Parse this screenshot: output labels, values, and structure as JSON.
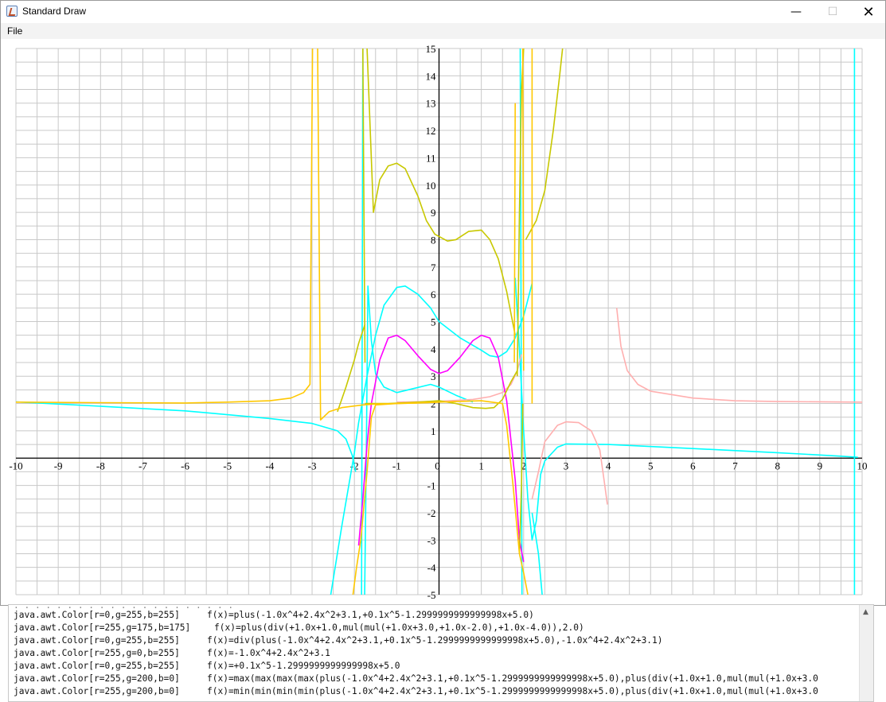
{
  "window": {
    "title": "Standard Draw",
    "minimize_label": "—",
    "maximize_label": "☐",
    "close_label": "✕",
    "menu": [
      "File"
    ]
  },
  "chart_data": {
    "type": "line",
    "title": "",
    "xlabel": "",
    "ylabel": "",
    "xlim": [
      -10,
      10
    ],
    "ylim": [
      -5,
      15
    ],
    "grid": true,
    "x_ticks": [
      "-10",
      "-9",
      "-8",
      "-7",
      "-6",
      "-5",
      "-4",
      "-3",
      "-2",
      "-1",
      "0",
      "1",
      "2",
      "3",
      "4",
      "5",
      "6",
      "7",
      "8",
      "9",
      "10"
    ],
    "y_ticks": [
      "-5",
      "-4",
      "-3",
      "-2",
      "-1",
      "1",
      "2",
      "3",
      "4",
      "5",
      "6",
      "7",
      "8",
      "9",
      "10",
      "11",
      "12",
      "13",
      "14",
      "15"
    ],
    "series": [
      {
        "color": "#00ffff",
        "points": [
          [
            -10,
            2.06
          ],
          [
            -8,
            1.9
          ],
          [
            -6,
            1.73
          ],
          [
            -4,
            1.45
          ],
          [
            -3,
            1.27
          ],
          [
            -2.4,
            1.0
          ],
          [
            -2.2,
            0.7
          ],
          [
            -2.05,
            0.1
          ],
          [
            -1.97,
            -0.5
          ]
        ]
      },
      {
        "color": "#00ffff",
        "points": [
          [
            -2.6,
            -5.4
          ],
          [
            -2.3,
            -2.5
          ],
          [
            -2.0,
            0.2
          ],
          [
            -1.9,
            1.3
          ],
          [
            -1.7,
            3.0
          ],
          [
            -1.5,
            4.5
          ],
          [
            -1.3,
            5.6
          ],
          [
            -1.0,
            6.25
          ],
          [
            -0.8,
            6.3
          ],
          [
            -0.5,
            6.0
          ],
          [
            -0.2,
            5.5
          ],
          [
            0,
            5.0
          ],
          [
            0.5,
            4.4
          ],
          [
            1.0,
            3.95
          ],
          [
            1.2,
            3.75
          ],
          [
            1.4,
            3.7
          ],
          [
            1.6,
            3.9
          ],
          [
            1.8,
            4.4
          ],
          [
            2.0,
            5.2
          ],
          [
            2.1,
            5.8
          ],
          [
            2.2,
            6.4
          ]
        ]
      },
      {
        "color": "#00ffff",
        "points": [
          [
            -1.76,
            -5.2
          ],
          [
            -1.72,
            0
          ],
          [
            -1.68,
            6.3
          ],
          [
            -1.6,
            4.3
          ],
          [
            -1.5,
            3.1
          ],
          [
            -1.3,
            2.6
          ],
          [
            -1.0,
            2.4
          ],
          [
            -0.6,
            2.55
          ],
          [
            -0.2,
            2.7
          ],
          [
            0,
            2.6
          ],
          [
            0.4,
            2.3
          ],
          [
            0.8,
            2.05
          ]
        ]
      },
      {
        "color": "#00ffff",
        "points": [
          [
            1.8,
            6.6
          ],
          [
            1.9,
            4.0
          ],
          [
            2.0,
            1.0
          ],
          [
            2.1,
            -1.5
          ],
          [
            2.2,
            -3.0
          ],
          [
            2.3,
            -2.3
          ],
          [
            2.4,
            -0.6
          ],
          [
            2.5,
            -0.1
          ],
          [
            2.8,
            0.4
          ],
          [
            3.0,
            0.52
          ],
          [
            4.0,
            0.5
          ],
          [
            6.0,
            0.35
          ],
          [
            8.0,
            0.2
          ],
          [
            9.5,
            0.07
          ],
          [
            9.9,
            0.03
          ]
        ]
      },
      {
        "color": "#00ffff",
        "points": [
          [
            2.2,
            -2.0
          ],
          [
            2.35,
            -3.5
          ],
          [
            2.45,
            -5.2
          ]
        ]
      },
      {
        "color": "#00ffff",
        "points": [
          [
            -1.83,
            -5
          ],
          [
            -1.8,
            15
          ]
        ]
      },
      {
        "color": "#00ffff",
        "points": [
          [
            1.92,
            15
          ],
          [
            1.96,
            -5
          ]
        ]
      },
      {
        "color": "#00ffff",
        "points": [
          [
            9.82,
            -5
          ],
          [
            9.82,
            15
          ]
        ]
      },
      {
        "color": "#ffafaf",
        "points": [
          [
            -1.0,
            2.05
          ],
          [
            0,
            2.08
          ],
          [
            0.8,
            2.15
          ],
          [
            1.2,
            2.25
          ],
          [
            1.5,
            2.4
          ],
          [
            1.7,
            2.7
          ],
          [
            1.85,
            3.2
          ],
          [
            1.95,
            3.8
          ]
        ]
      },
      {
        "color": "#ffafaf",
        "points": [
          [
            2.2,
            -1.5
          ],
          [
            2.35,
            -0.5
          ],
          [
            2.5,
            0.6
          ],
          [
            2.8,
            1.2
          ],
          [
            3.0,
            1.33
          ],
          [
            3.3,
            1.3
          ],
          [
            3.6,
            1.0
          ],
          [
            3.8,
            0.3
          ],
          [
            3.9,
            -0.8
          ],
          [
            3.98,
            -1.7
          ]
        ]
      },
      {
        "color": "#ffafaf",
        "points": [
          [
            4.2,
            5.5
          ],
          [
            4.3,
            4.1
          ],
          [
            4.45,
            3.2
          ],
          [
            4.7,
            2.7
          ],
          [
            5.0,
            2.45
          ],
          [
            6.0,
            2.2
          ],
          [
            7.0,
            2.1
          ],
          [
            8.0,
            2.07
          ],
          [
            10.0,
            2.05
          ]
        ]
      },
      {
        "color": "#ff00ff",
        "points": [
          [
            -1.9,
            -3.2
          ],
          [
            -1.8,
            -1.5
          ],
          [
            -1.7,
            0.5
          ],
          [
            -1.6,
            2.0
          ],
          [
            -1.4,
            3.6
          ],
          [
            -1.2,
            4.4
          ],
          [
            -1.0,
            4.5
          ],
          [
            -0.8,
            4.3
          ],
          [
            -0.5,
            3.75
          ],
          [
            -0.2,
            3.25
          ],
          [
            0,
            3.1
          ],
          [
            0.2,
            3.2
          ],
          [
            0.5,
            3.7
          ],
          [
            0.8,
            4.3
          ],
          [
            1.0,
            4.5
          ],
          [
            1.2,
            4.4
          ],
          [
            1.4,
            3.7
          ],
          [
            1.6,
            2.1
          ],
          [
            1.8,
            -0.8
          ],
          [
            1.9,
            -3.0
          ],
          [
            2.0,
            -3.8
          ]
        ]
      },
      {
        "color": "#c8c800",
        "points": [
          [
            -2.4,
            1.7
          ],
          [
            -2.2,
            2.6
          ],
          [
            -2.0,
            3.6
          ],
          [
            -1.9,
            4.2
          ],
          [
            -1.75,
            4.9
          ]
        ]
      },
      {
        "color": "#c8c800",
        "points": [
          [
            -1.7,
            15
          ],
          [
            -1.55,
            9.0
          ],
          [
            -1.4,
            10.2
          ],
          [
            -1.2,
            10.7
          ],
          [
            -1.0,
            10.8
          ],
          [
            -0.8,
            10.6
          ],
          [
            -0.5,
            9.6
          ],
          [
            -0.3,
            8.7
          ],
          [
            -0.1,
            8.2
          ],
          [
            0.2,
            7.95
          ],
          [
            0.4,
            8.0
          ],
          [
            0.7,
            8.3
          ],
          [
            1.0,
            8.35
          ],
          [
            1.2,
            8.0
          ],
          [
            1.4,
            7.3
          ],
          [
            1.6,
            6.1
          ],
          [
            1.8,
            4.5
          ]
        ]
      },
      {
        "color": "#c8c800",
        "points": [
          [
            -1.75,
            2.0
          ],
          [
            -1.2,
            2.0
          ],
          [
            -0.5,
            2.05
          ],
          [
            0,
            2.1
          ],
          [
            0.4,
            2.0
          ],
          [
            0.8,
            1.85
          ],
          [
            1.1,
            1.82
          ],
          [
            1.3,
            1.85
          ],
          [
            1.5,
            2.15
          ],
          [
            1.7,
            2.8
          ],
          [
            1.85,
            3.2
          ]
        ]
      },
      {
        "color": "#c8c800",
        "points": [
          [
            -1.75,
            3.5
          ],
          [
            -1.8,
            15
          ]
        ]
      },
      {
        "color": "#c8c800",
        "points": [
          [
            1.85,
            3.0
          ],
          [
            1.9,
            9.0
          ],
          [
            1.95,
            13.5
          ],
          [
            2.0,
            15
          ]
        ]
      },
      {
        "color": "#c8c800",
        "points": [
          [
            2.05,
            8.0
          ],
          [
            2.3,
            8.7
          ],
          [
            2.5,
            9.8
          ],
          [
            2.7,
            12.0
          ],
          [
            2.85,
            14.0
          ],
          [
            2.92,
            15
          ]
        ]
      },
      {
        "color": "#c8c800",
        "points": [
          [
            1.9,
            -3.5
          ],
          [
            1.95,
            -1.0
          ],
          [
            1.98,
            2.0
          ]
        ]
      },
      {
        "color": "#ffc800",
        "points": [
          [
            -10,
            2.05
          ],
          [
            -8,
            2.03
          ],
          [
            -6,
            2.02
          ],
          [
            -5,
            2.05
          ],
          [
            -4,
            2.1
          ],
          [
            -3.5,
            2.2
          ],
          [
            -3.2,
            2.4
          ],
          [
            -3.05,
            2.7
          ],
          [
            -2.99,
            15
          ]
        ]
      },
      {
        "color": "#ffc800",
        "points": [
          [
            -2.87,
            15
          ],
          [
            -2.8,
            1.4
          ],
          [
            -2.6,
            1.7
          ],
          [
            -2.3,
            1.85
          ],
          [
            -1.8,
            1.95
          ],
          [
            -1.5,
            1.98
          ],
          [
            -0.5,
            2.02
          ],
          [
            0,
            2.05
          ]
        ]
      },
      {
        "color": "#ffc800",
        "points": [
          [
            -2.05,
            -5.2
          ],
          [
            -1.95,
            -4.0
          ],
          [
            -1.85,
            -3.0
          ],
          [
            -1.7,
            -0.5
          ],
          [
            -1.6,
            1.5
          ],
          [
            -1.5,
            1.95
          ],
          [
            -1.0,
            2.0
          ],
          [
            0,
            2.05
          ],
          [
            1.0,
            2.1
          ],
          [
            1.5,
            2.0
          ],
          [
            1.6,
            1.2
          ],
          [
            1.75,
            -1.0
          ],
          [
            1.9,
            -3.5
          ],
          [
            2.0,
            -4.2
          ],
          [
            2.1,
            -5.0
          ],
          [
            2.15,
            -5.5
          ]
        ]
      },
      {
        "color": "#ffc800",
        "points": [
          [
            1.78,
            3.5
          ],
          [
            1.8,
            13.0
          ]
        ]
      },
      {
        "color": "#ffc800",
        "points": [
          [
            1.98,
            15
          ],
          [
            2.0,
            3.2
          ]
        ]
      },
      {
        "color": "#ffc800",
        "points": [
          [
            2.2,
            15
          ],
          [
            2.2,
            2.0
          ]
        ]
      }
    ]
  },
  "console": {
    "lines": [
      {
        "color": "java.awt.Color[r=0,g=255,b=255]",
        "fn": "f(x)=plus(-1.0x^4+2.4x^2+3.1,+0.1x^5-1.2999999999999998x+5.0)"
      },
      {
        "color": "java.awt.Color[r=255,g=175,b=175]",
        "fn": "f(x)=plus(div(+1.0x+1.0,mul(mul(+1.0x+3.0,+1.0x-2.0),+1.0x-4.0)),2.0)"
      },
      {
        "color": "java.awt.Color[r=0,g=255,b=255]",
        "fn": "f(x)=div(plus(-1.0x^4+2.4x^2+3.1,+0.1x^5-1.2999999999999998x+5.0),-1.0x^4+2.4x^2+3.1)"
      },
      {
        "color": "java.awt.Color[r=255,g=0,b=255]",
        "fn": "f(x)=-1.0x^4+2.4x^2+3.1"
      },
      {
        "color": "java.awt.Color[r=0,g=255,b=255]",
        "fn": "f(x)=+0.1x^5-1.2999999999999998x+5.0"
      },
      {
        "color": "java.awt.Color[r=255,g=200,b=0]",
        "fn": "f(x)=max(max(max(max(plus(-1.0x^4+2.4x^2+3.1,+0.1x^5-1.2999999999999998x+5.0),plus(div(+1.0x+1.0,mul(mul(+1.0x+3.0"
      },
      {
        "color": "java.awt.Color[r=255,g=200,b=0]",
        "fn": "f(x)=min(min(min(min(plus(-1.0x^4+2.4x^2+3.1,+0.1x^5-1.2999999999999998x+5.0),plus(div(+1.0x+1.0,mul(mul(+1.0x+3.0"
      }
    ]
  }
}
